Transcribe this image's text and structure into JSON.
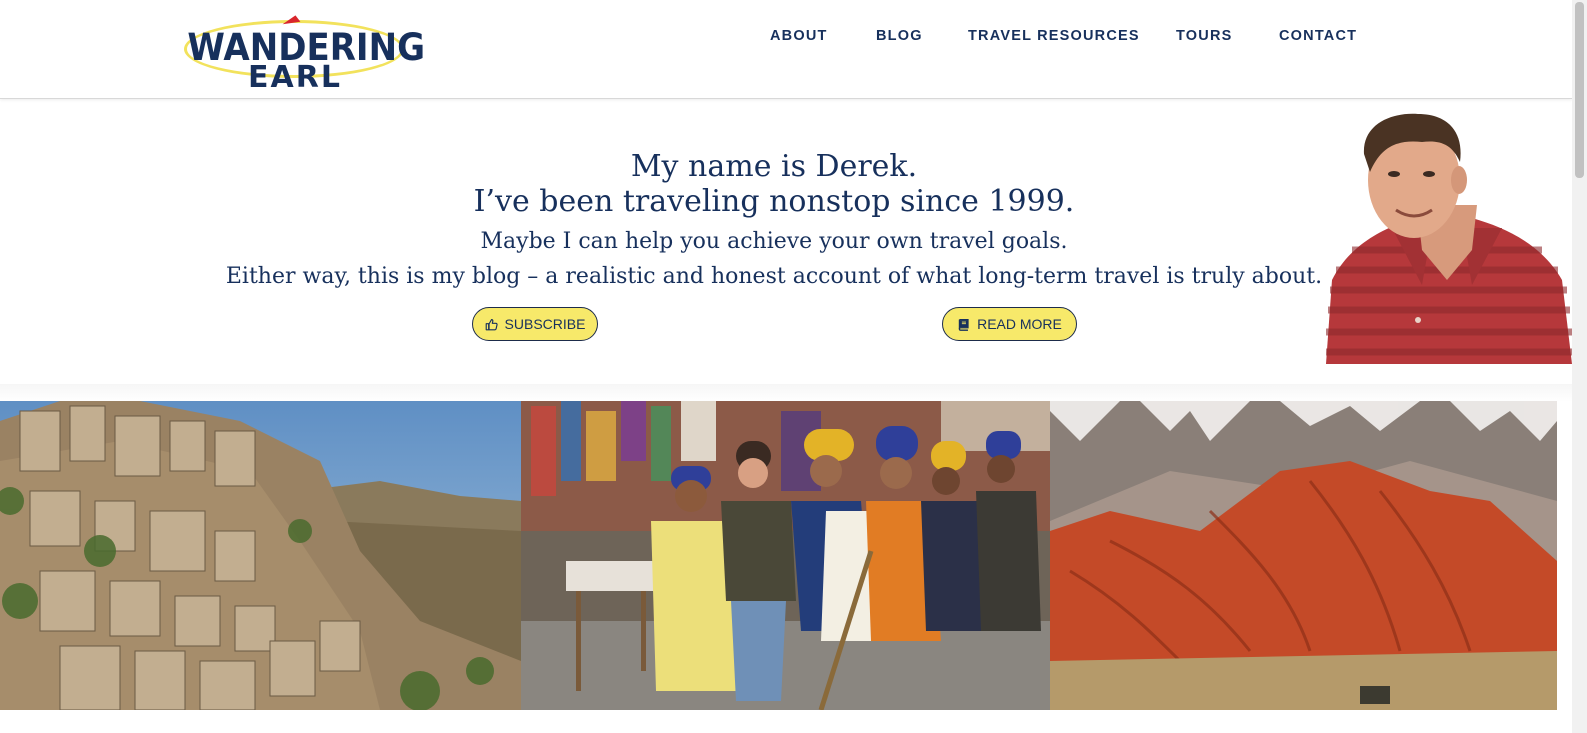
{
  "logo": {
    "line1": "WANDERING",
    "line2": "EARL"
  },
  "nav": {
    "items": [
      {
        "label": "ABOUT"
      },
      {
        "label": "BLOG"
      },
      {
        "label": "TRAVEL RESOURCES"
      },
      {
        "label": "TOURS"
      },
      {
        "label": "CONTACT"
      }
    ]
  },
  "hero": {
    "line1": "My name is Derek.",
    "line2": "I’ve been traveling nonstop since 1999.",
    "line3": "Maybe I can help you achieve your own travel goals.",
    "line4": "Either way, this is my blog – a realistic and honest account of what long-term travel is truly about.",
    "subscribe_label": "SUBSCRIBE",
    "readmore_label": "READ MORE",
    "subscribe_icon": "thumbs-up-icon",
    "readmore_icon": "book-icon"
  },
  "colors": {
    "navy": "#17305c",
    "button_yellow": "#f7e96a",
    "logo_ring": "#f2e25c",
    "logo_plane": "#d9262c"
  }
}
